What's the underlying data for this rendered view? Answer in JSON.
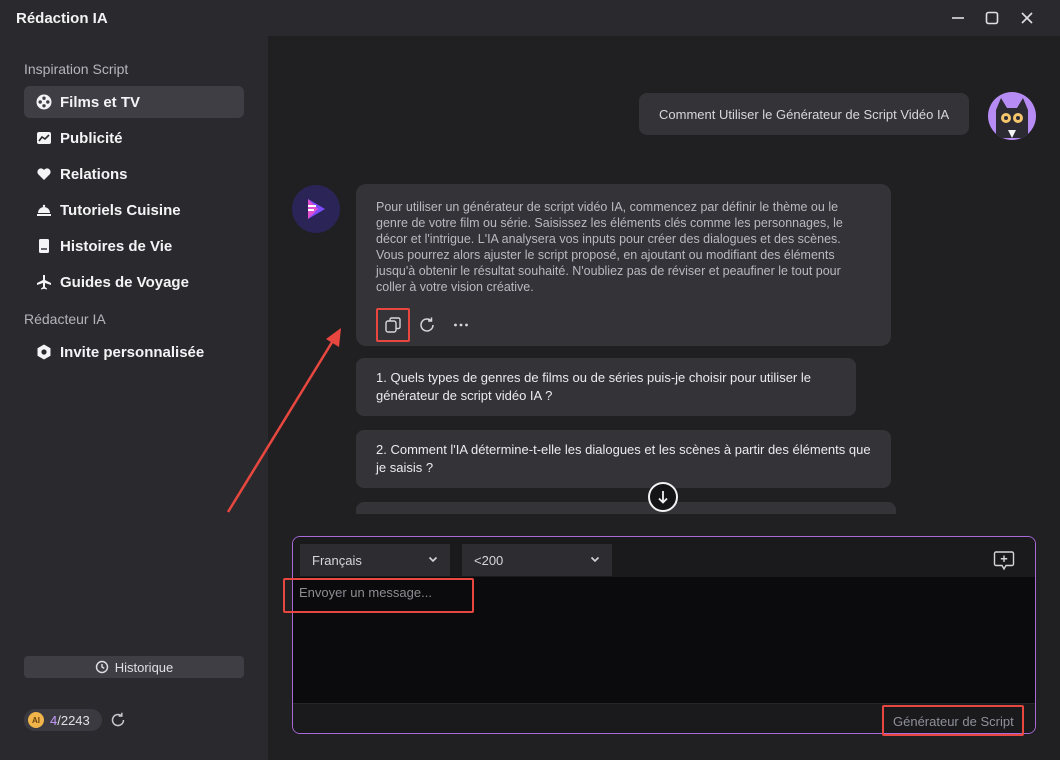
{
  "window": {
    "title": "Rédaction IA"
  },
  "sidebar": {
    "section1": "Inspiration Script",
    "items": [
      {
        "label": "Films et TV",
        "icon": "film-reel-icon",
        "active": true
      },
      {
        "label": "Publicité",
        "icon": "chart-icon"
      },
      {
        "label": "Relations",
        "icon": "heart-icon"
      },
      {
        "label": "Tutoriels Cuisine",
        "icon": "cloche-icon"
      },
      {
        "label": "Histoires de Vie",
        "icon": "book-icon"
      },
      {
        "label": "Guides de Voyage",
        "icon": "airplane-icon"
      }
    ],
    "section2": "Rédacteur IA",
    "custom": {
      "label": "Invite personnalisée",
      "icon": "gear-icon"
    },
    "history_label": "Historique",
    "credits": {
      "badge": "AI",
      "used": "4",
      "total": "/2243"
    }
  },
  "chat": {
    "user_message": "Comment Utiliser le Générateur de Script Vidéo IA",
    "bot_message": "Pour utiliser un générateur de script vidéo IA, commencez par définir le thème ou le genre de votre film ou série. Saisissez les éléments clés comme les personnages, le décor et l'intrigue. L'IA analysera vos inputs pour créer des dialogues et des scènes. Vous pourrez alors ajuster le script proposé, en ajoutant ou modifiant des éléments jusqu'à obtenir le résultat souhaité. N'oubliez pas de réviser et peaufiner le tout pour coller à votre vision créative.",
    "suggestions": [
      "1. Quels types de genres de films ou de séries puis-je choisir pour utiliser le générateur de script vidéo IA ?",
      "2. Comment l'IA détermine-t-elle les dialogues et les scènes à partir des éléments que je saisis ?"
    ]
  },
  "composer": {
    "language": "Français",
    "length": "<200",
    "placeholder": "Envoyer un message...",
    "generate_label": "Générateur de Script"
  },
  "colors": {
    "accent_border": "#a86ad8",
    "highlight": "#e8473f",
    "bg": "#202023",
    "sidebar": "#2a2a2e"
  }
}
